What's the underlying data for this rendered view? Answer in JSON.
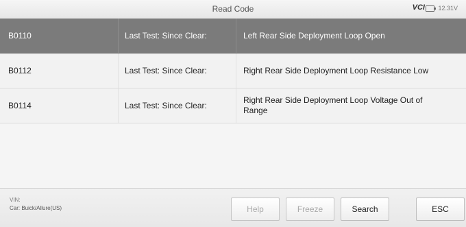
{
  "header": {
    "title": "Read Code",
    "vci_label": "VCI",
    "voltage": "12.31V"
  },
  "rows": [
    {
      "code": "B0110",
      "status": "Last Test: Since Clear:",
      "description": "Left Rear Side Deployment Loop Open"
    },
    {
      "code": "B0112",
      "status": "Last Test: Since Clear:",
      "description": "Right Rear Side Deployment Loop Resistance Low"
    },
    {
      "code": "B0114",
      "status": "Last Test: Since Clear:",
      "description": "Right Rear Side Deployment Loop Voltage Out of Range"
    }
  ],
  "footer": {
    "vin_label": "VIN:",
    "car_label": "Car: Buick/Allure(US)",
    "buttons": {
      "help": "Help",
      "freeze": "Freeze",
      "search": "Search",
      "esc": "ESC"
    }
  }
}
